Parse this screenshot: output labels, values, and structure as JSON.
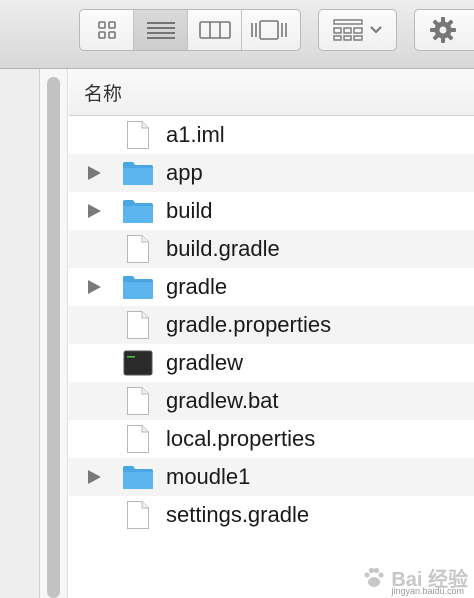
{
  "toolbar": {
    "view_buttons": [
      {
        "name": "icon-view-button",
        "icon": "grid-icon"
      },
      {
        "name": "list-view-button",
        "icon": "list-icon",
        "active": true
      },
      {
        "name": "column-view-button",
        "icon": "columns-icon"
      },
      {
        "name": "coverflow-view-button",
        "icon": "coverflow-icon"
      }
    ],
    "arrange_button": {
      "icon": "arrange-icon",
      "chevron": "chevron-down-icon"
    },
    "action_button": {
      "icon": "gear-icon"
    }
  },
  "list": {
    "column_header": "名称",
    "files": [
      {
        "name": "a1.iml",
        "kind": "document",
        "expandable": false
      },
      {
        "name": "app",
        "kind": "folder",
        "expandable": true
      },
      {
        "name": "build",
        "kind": "folder",
        "expandable": true
      },
      {
        "name": "build.gradle",
        "kind": "document",
        "expandable": false
      },
      {
        "name": "gradle",
        "kind": "folder",
        "expandable": true
      },
      {
        "name": "gradle.properties",
        "kind": "document",
        "expandable": false
      },
      {
        "name": "gradlew",
        "kind": "executable",
        "expandable": false
      },
      {
        "name": "gradlew.bat",
        "kind": "document",
        "expandable": false
      },
      {
        "name": "local.properties",
        "kind": "document",
        "expandable": false
      },
      {
        "name": "moudle1",
        "kind": "folder",
        "expandable": true
      },
      {
        "name": "settings.gradle",
        "kind": "document",
        "expandable": false
      }
    ]
  },
  "watermark": {
    "text": "Bai  经验",
    "sub": "jingyan.baidu.com"
  },
  "colors": {
    "folder": "#5bb6f0",
    "folder_tab": "#4aa6e2",
    "row_alt": "#f4f4f4",
    "terminal": "#2a2a2a"
  }
}
